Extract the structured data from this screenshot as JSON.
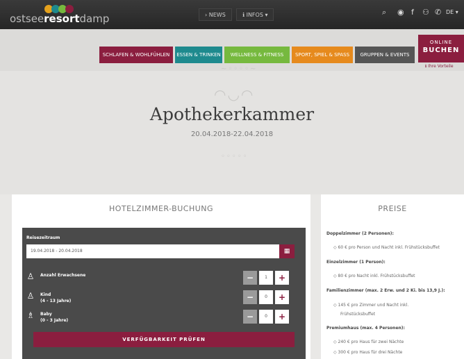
{
  "header": {
    "logo_prefix": "ostsee",
    "logo_bold": "resort",
    "logo_suffix": "damp",
    "nav_news": "› NEWS",
    "nav_infos": "ℹ INFOS ▾",
    "lang": "DE ▾"
  },
  "menu": [
    {
      "label": "SCHLAFEN & WOHLFÜHLEN",
      "color": "#8b1e3f"
    },
    {
      "label": "ESSEN & TRINKEN",
      "color": "#1e8a8e"
    },
    {
      "label": "WELLNESS & FITNESS",
      "color": "#76b93e"
    },
    {
      "label": "SPORT, SPIEL & SPASS",
      "color": "#e68a1d"
    },
    {
      "label": "GRUPPEN & EVENTS",
      "color": "#555555"
    }
  ],
  "online_booking": {
    "line1": "ONLINE",
    "line2": "BUCHEN"
  },
  "perks": "ℹ  Ihre Vorteile",
  "hero": {
    "title": "Apothekerkammer",
    "date": "20.04.2018-22.04.2018"
  },
  "booking": {
    "title": "HOTELZIMMER-BUCHUNG",
    "period_label": "Reisezeitraum",
    "period_value": "19.04.2018 - 20.04.2018",
    "adults_label": "Anzahl Erwachsene",
    "adults_value": "1",
    "child_label": "Kind",
    "child_sub": "(4 - 13 Jahre)",
    "child_value": "0",
    "baby_label": "Baby",
    "baby_sub": "(0 - 3 Jahre)",
    "baby_value": "0",
    "check_button": "VERFÜGBARKEIT PRÜFEN"
  },
  "prices": {
    "title": "PREISE",
    "double": "Doppelzimmer (2 Personen):",
    "double_1": "60 € pro Person und Nacht inkl. Frühstücksbuffet",
    "single": "Einzelzimmer (1 Person):",
    "single_1": "80 € pro Nacht inkl. Frühstücksbuffet",
    "family": "Familienzimmer (max. 2 Erw. und 2 Ki. bis 13,9 J.):",
    "family_1": "145 € pro Zimmer und Nacht inkl.",
    "family_2": "Frühstücksbuffet",
    "premium": "Premiumhaus (max. 4 Personen):",
    "premium_1": "240 € pro Haus für zwei Nächte",
    "premium_2": "300 € pro Haus für drei Nächte"
  }
}
